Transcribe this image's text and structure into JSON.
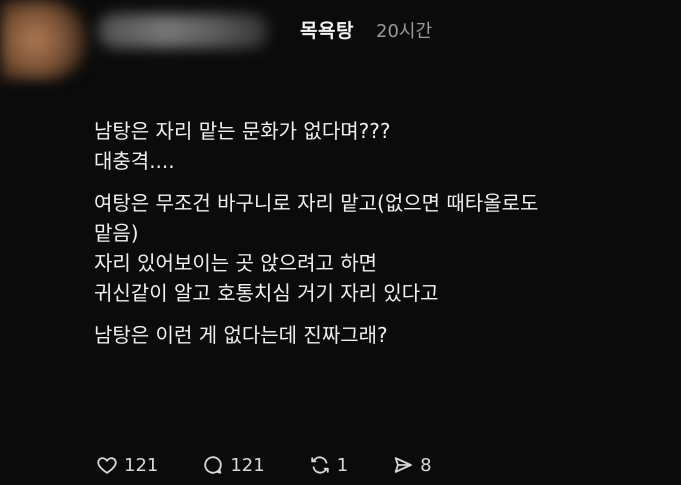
{
  "header": {
    "community": "목욕탕",
    "time": "20시간"
  },
  "post": {
    "paragraphs": [
      [
        "남탕은 자리 맡는 문화가 없다며???",
        "대충격...."
      ],
      [
        "여탕은 무조건 바구니로 자리 맡고(없으면 때타올로도",
        "맡음)",
        "자리 있어보이는 곳 앉으려고 하면",
        "귀신같이 알고 호통치심 거기 자리 있다고"
      ],
      [
        "남탕은 이런 게 없다는데 진짜그래?"
      ]
    ]
  },
  "actions": {
    "like": {
      "icon": "heart-icon",
      "count": "121"
    },
    "comment": {
      "icon": "comment-icon",
      "count": "121"
    },
    "repost": {
      "icon": "repost-icon",
      "count": "1"
    },
    "share": {
      "icon": "send-icon",
      "count": "8"
    }
  }
}
